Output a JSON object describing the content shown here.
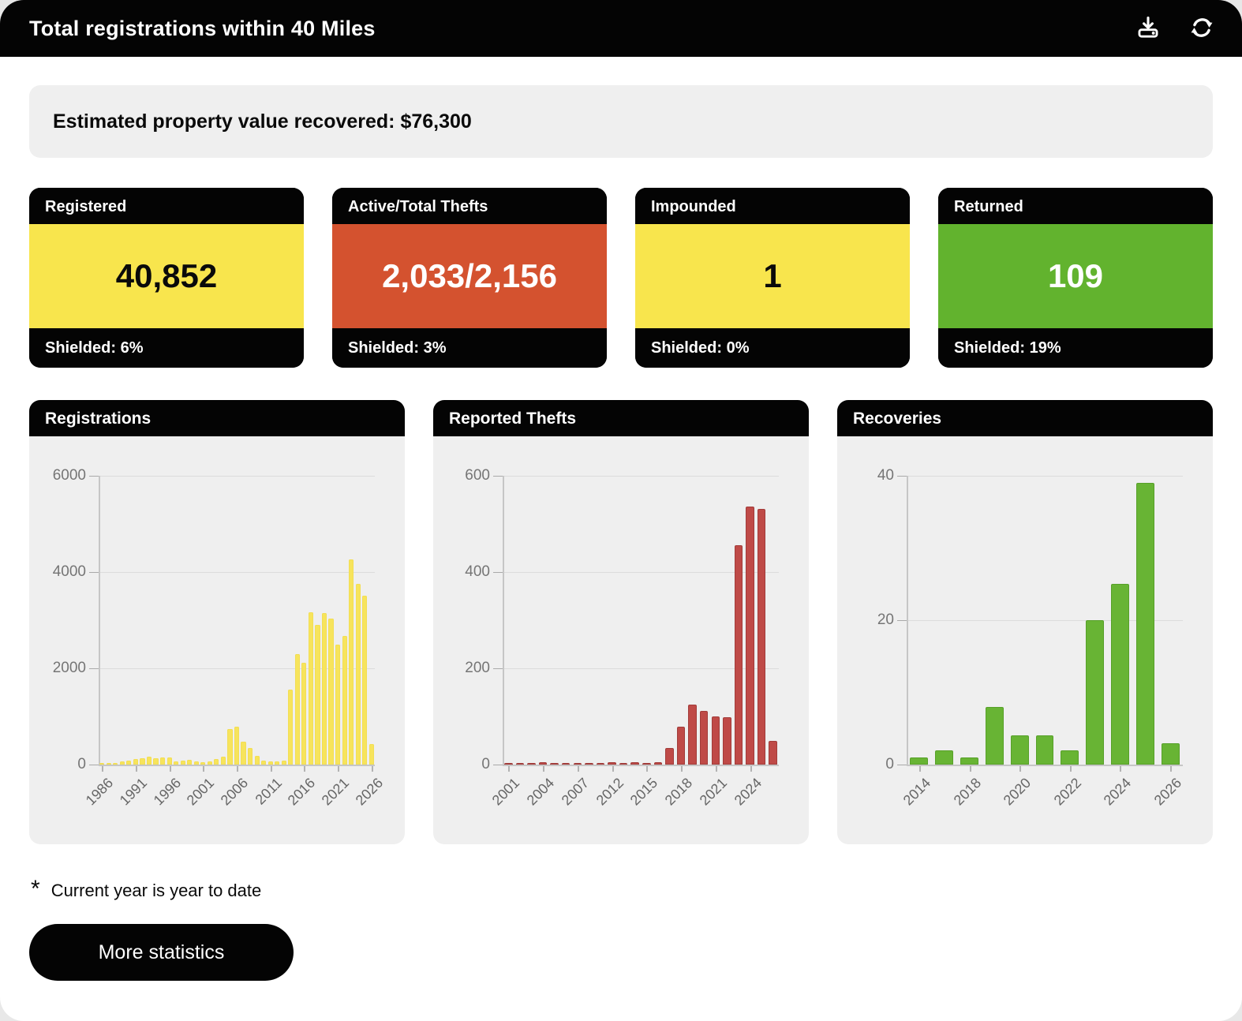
{
  "header": {
    "title": "Total registrations within 40 Miles",
    "actions": [
      "download",
      "refresh"
    ]
  },
  "banner": {
    "text": "Estimated property value recovered: $76,300"
  },
  "stat_cards": [
    {
      "label": "Registered",
      "value": "40,852",
      "footer": "Shielded: 6%",
      "color": "#F8E54D",
      "text_color": "#0a0a0a"
    },
    {
      "label": "Active/Total Thefts",
      "value": "2,033/2,156",
      "footer": "Shielded: 3%",
      "color": "#D4522F",
      "text_color": "#ffffff"
    },
    {
      "label": "Impounded",
      "value": "1",
      "footer": "Shielded: 0%",
      "color": "#F8E54D",
      "text_color": "#0a0a0a"
    },
    {
      "label": "Returned",
      "value": "109",
      "footer": "Shielded: 19%",
      "color": "#62B32E",
      "text_color": "#ffffff"
    }
  ],
  "chart_data": [
    {
      "type": "bar",
      "title": "Registrations",
      "xlabel": "",
      "ylabel": "",
      "grid": true,
      "legend": "none",
      "ylim": [
        0,
        6000
      ],
      "yticks": [
        0,
        2000,
        4000,
        6000
      ],
      "bar_color": "#F7E45C",
      "bar_border": "#EDD94B",
      "categories": [
        "1986",
        "1987",
        "1988",
        "1989",
        "1990",
        "1991",
        "1992",
        "1993",
        "1994",
        "1995",
        "1996",
        "1997",
        "1998",
        "1999",
        "2000",
        "2001",
        "2002",
        "2003",
        "2004",
        "2005",
        "2006",
        "2007",
        "2008",
        "2009",
        "2010",
        "2011",
        "2012",
        "2013",
        "2014",
        "2015",
        "2016",
        "2017",
        "2018",
        "2019",
        "2020",
        "2021",
        "2022",
        "2023",
        "2024",
        "2025",
        "2026"
      ],
      "values": [
        10,
        20,
        40,
        70,
        90,
        110,
        130,
        160,
        130,
        140,
        140,
        60,
        80,
        100,
        60,
        50,
        70,
        110,
        170,
        740,
        780,
        475,
        340,
        175,
        90,
        70,
        60,
        80,
        1550,
        2300,
        2110,
        3170,
        2900,
        3140,
        3030,
        2490,
        2680,
        4260,
        3755,
        3510,
        420
      ],
      "label_indices": [
        0,
        5,
        10,
        15,
        20,
        25,
        30,
        35,
        40
      ]
    },
    {
      "type": "bar",
      "title": "Reported Thefts",
      "xlabel": "",
      "ylabel": "",
      "grid": true,
      "legend": "none",
      "ylim": [
        0,
        600
      ],
      "yticks": [
        0,
        200,
        400,
        600
      ],
      "bar_color": "#BF4A47",
      "bar_border": "#A23C3A",
      "categories": [
        "2001",
        "2002",
        "2003",
        "2004",
        "2005",
        "2006",
        "2007",
        "2008",
        "2009",
        "2012",
        "2013",
        "2014",
        "2015",
        "2016",
        "2017",
        "2018",
        "2019",
        "2020",
        "2021",
        "2022",
        "2023",
        "2024",
        "2025",
        "2026"
      ],
      "values": [
        2,
        1,
        1,
        5,
        4,
        2,
        2,
        1,
        2,
        5,
        1,
        5,
        1,
        5,
        35,
        78,
        124,
        111,
        100,
        99,
        455,
        536,
        531,
        50
      ],
      "label_indices": [
        0,
        3,
        6,
        9,
        12,
        15,
        18,
        21
      ]
    },
    {
      "type": "bar",
      "title": "Recoveries",
      "xlabel": "",
      "ylabel": "",
      "grid": true,
      "legend": "none",
      "ylim": [
        0,
        40
      ],
      "yticks": [
        0,
        20,
        40
      ],
      "bar_color": "#68B434",
      "bar_border": "#57A029",
      "categories": [
        "2014",
        "2017",
        "2018",
        "2019",
        "2020",
        "2021",
        "2022",
        "2023",
        "2024",
        "2025",
        "2026"
      ],
      "values": [
        1,
        2,
        1,
        8,
        4,
        4,
        2,
        20,
        25,
        39,
        3
      ],
      "label_indices": [
        0,
        2,
        4,
        6,
        8,
        10
      ]
    }
  ],
  "footnote": {
    "marker": "*",
    "text": "Current year is year to date"
  },
  "buttons": {
    "more_statistics": "More statistics"
  }
}
